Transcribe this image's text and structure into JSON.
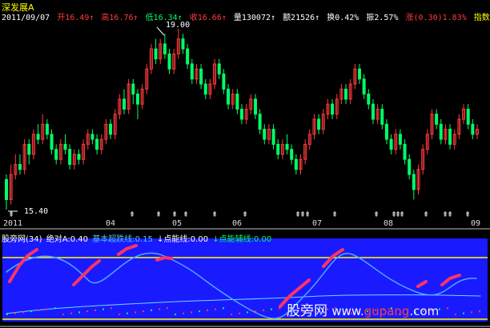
{
  "stock": {
    "name": "深发展A"
  },
  "quote": {
    "date": "2011/09/07",
    "open": "开16.49↑",
    "high": "高16.76↑",
    "low": "低16.34↑",
    "close": "收16.66↑",
    "volume": "量130072↑",
    "amount": "额21526↑",
    "turnover": "换0.42%",
    "amplitude": "振2.57%",
    "change": "涨(0.30)1.83%",
    "index_tab": "指数"
  },
  "chart_labels": {
    "high": "19.00",
    "low": "15.40"
  },
  "x_ticks": [
    "2011",
    "04",
    "05",
    "06",
    "07",
    "08",
    "09"
  ],
  "indicator": {
    "name": "股旁网(34)",
    "abs_a": "绝对A:0.40",
    "basic_line": "基本超跌线:0.15",
    "point_line": "↓点能线:0.00",
    "point_aux": "↓点能辅线:0.00"
  },
  "watermark": {
    "cn": "股旁网",
    "url_a": "www.",
    "url_b": "gupang",
    "url_c": ".com"
  },
  "colors": {
    "background": "#000000",
    "up": "#ff3b3b",
    "down": "#00ff66",
    "yellow": "#ffff00",
    "blue": "#1a1aff",
    "cyan": "#6fd6ff",
    "separator": "#c0c0c0"
  },
  "chart_data": {
    "type": "candlestick",
    "price_range": [
      15.4,
      19.0
    ],
    "price_hint": "daily K-line Jan–Sep 2011",
    "candles": [
      [
        16.0,
        15.6,
        16.1,
        15.4
      ],
      [
        15.6,
        16.1,
        16.3,
        15.5
      ],
      [
        16.1,
        16.3,
        16.5,
        16.0
      ],
      [
        16.3,
        16.2,
        16.5,
        16.1
      ],
      [
        16.2,
        16.7,
        16.8,
        16.1
      ],
      [
        16.7,
        16.5,
        16.8,
        16.3
      ],
      [
        16.5,
        16.9,
        17.0,
        16.4
      ],
      [
        16.9,
        16.8,
        17.1,
        16.7
      ],
      [
        16.8,
        17.1,
        17.3,
        16.7
      ],
      [
        17.1,
        16.9,
        17.2,
        16.8
      ],
      [
        16.9,
        16.6,
        17.0,
        16.5
      ],
      [
        16.6,
        16.4,
        16.7,
        16.3
      ],
      [
        16.4,
        16.7,
        16.8,
        16.3
      ],
      [
        16.7,
        16.6,
        16.9,
        16.5
      ],
      [
        16.6,
        16.3,
        16.7,
        16.2
      ],
      [
        16.3,
        16.5,
        16.6,
        16.2
      ],
      [
        16.5,
        16.4,
        16.6,
        16.3
      ],
      [
        16.4,
        16.7,
        16.8,
        16.3
      ],
      [
        16.7,
        16.9,
        17.0,
        16.6
      ],
      [
        16.9,
        16.8,
        17.0,
        16.7
      ],
      [
        16.8,
        16.6,
        16.9,
        16.5
      ],
      [
        16.6,
        16.8,
        16.9,
        16.5
      ],
      [
        16.8,
        17.1,
        17.2,
        16.7
      ],
      [
        17.1,
        16.9,
        17.2,
        16.8
      ],
      [
        16.9,
        17.3,
        17.4,
        16.8
      ],
      [
        17.3,
        17.6,
        17.7,
        17.2
      ],
      [
        17.6,
        17.4,
        17.8,
        17.3
      ],
      [
        17.4,
        17.9,
        18.0,
        17.3
      ],
      [
        17.9,
        17.7,
        18.0,
        17.5
      ],
      [
        17.7,
        17.5,
        17.8,
        17.2
      ],
      [
        17.5,
        17.8,
        17.9,
        17.4
      ],
      [
        17.8,
        18.2,
        18.3,
        17.7
      ],
      [
        18.2,
        18.6,
        18.7,
        18.1
      ],
      [
        18.6,
        18.4,
        18.8,
        18.3
      ],
      [
        18.4,
        18.7,
        18.8,
        18.3
      ],
      [
        18.7,
        18.5,
        18.9,
        18.4
      ],
      [
        18.5,
        18.2,
        18.6,
        18.1
      ],
      [
        18.2,
        18.5,
        18.6,
        18.1
      ],
      [
        18.5,
        18.8,
        19.0,
        18.4
      ],
      [
        18.8,
        18.6,
        18.9,
        18.5
      ],
      [
        18.6,
        18.3,
        18.7,
        18.2
      ],
      [
        18.3,
        18.0,
        18.4,
        17.9
      ],
      [
        18.0,
        18.2,
        18.3,
        17.9
      ],
      [
        18.2,
        17.9,
        18.3,
        17.8
      ],
      [
        17.9,
        17.7,
        18.0,
        17.6
      ],
      [
        17.7,
        17.9,
        18.0,
        17.6
      ],
      [
        17.9,
        18.3,
        18.4,
        17.8
      ],
      [
        18.3,
        18.1,
        18.4,
        18.0
      ],
      [
        18.1,
        17.8,
        18.2,
        17.7
      ],
      [
        17.8,
        17.5,
        17.9,
        17.4
      ],
      [
        17.5,
        17.7,
        17.8,
        17.4
      ],
      [
        17.7,
        17.4,
        17.8,
        17.3
      ],
      [
        17.4,
        17.2,
        17.5,
        17.1
      ],
      [
        17.2,
        17.4,
        17.5,
        17.1
      ],
      [
        17.4,
        17.6,
        17.7,
        17.3
      ],
      [
        17.6,
        17.3,
        17.7,
        17.2
      ],
      [
        17.3,
        17.0,
        17.4,
        16.9
      ],
      [
        17.0,
        16.8,
        17.1,
        16.7
      ],
      [
        16.8,
        17.0,
        17.1,
        16.7
      ],
      [
        17.0,
        16.7,
        17.1,
        16.6
      ],
      [
        16.7,
        16.5,
        16.8,
        16.4
      ],
      [
        16.5,
        16.7,
        16.8,
        16.4
      ],
      [
        16.7,
        16.6,
        16.9,
        16.5
      ],
      [
        16.6,
        16.4,
        16.7,
        16.3
      ],
      [
        16.4,
        16.2,
        16.5,
        16.1
      ],
      [
        16.2,
        16.4,
        16.5,
        16.1
      ],
      [
        16.4,
        16.7,
        16.8,
        16.3
      ],
      [
        16.7,
        16.9,
        17.0,
        16.6
      ],
      [
        16.9,
        17.2,
        17.3,
        16.8
      ],
      [
        17.2,
        17.0,
        17.3,
        16.9
      ],
      [
        17.0,
        17.3,
        17.4,
        16.9
      ],
      [
        17.3,
        17.5,
        17.6,
        17.2
      ],
      [
        17.5,
        17.3,
        17.6,
        17.2
      ],
      [
        17.3,
        17.6,
        17.7,
        17.2
      ],
      [
        17.6,
        17.8,
        17.9,
        17.5
      ],
      [
        17.8,
        17.6,
        17.9,
        17.5
      ],
      [
        17.6,
        17.9,
        18.0,
        17.5
      ],
      [
        17.9,
        18.2,
        18.3,
        17.8
      ],
      [
        18.2,
        18.0,
        18.3,
        17.9
      ],
      [
        18.0,
        17.7,
        18.1,
        17.6
      ],
      [
        17.7,
        17.5,
        17.8,
        17.4
      ],
      [
        17.5,
        17.2,
        17.6,
        17.1
      ],
      [
        17.2,
        17.4,
        17.5,
        17.1
      ],
      [
        17.4,
        17.1,
        17.5,
        17.0
      ],
      [
        17.1,
        16.8,
        17.2,
        16.7
      ],
      [
        16.8,
        16.6,
        16.9,
        16.5
      ],
      [
        16.6,
        16.9,
        17.0,
        16.5
      ],
      [
        16.9,
        16.7,
        17.0,
        16.6
      ],
      [
        16.7,
        16.4,
        16.8,
        16.3
      ],
      [
        16.4,
        16.1,
        16.5,
        16.0
      ],
      [
        16.1,
        15.8,
        16.2,
        15.6
      ],
      [
        15.8,
        16.2,
        16.3,
        15.7
      ],
      [
        16.2,
        16.6,
        16.7,
        16.1
      ],
      [
        16.6,
        16.9,
        17.0,
        16.5
      ],
      [
        16.9,
        17.3,
        17.4,
        16.8
      ],
      [
        17.3,
        17.1,
        17.4,
        17.0
      ],
      [
        17.1,
        16.8,
        17.2,
        16.7
      ],
      [
        16.8,
        17.0,
        17.1,
        16.7
      ],
      [
        17.0,
        16.7,
        17.1,
        16.6
      ],
      [
        16.7,
        16.9,
        17.0,
        16.6
      ],
      [
        16.9,
        17.2,
        17.3,
        16.8
      ],
      [
        17.2,
        17.4,
        17.5,
        17.1
      ],
      [
        17.4,
        17.1,
        17.5,
        17.0
      ],
      [
        17.1,
        16.9,
        17.2,
        16.8
      ],
      [
        16.9,
        17.0,
        17.1,
        16.8
      ]
    ]
  }
}
